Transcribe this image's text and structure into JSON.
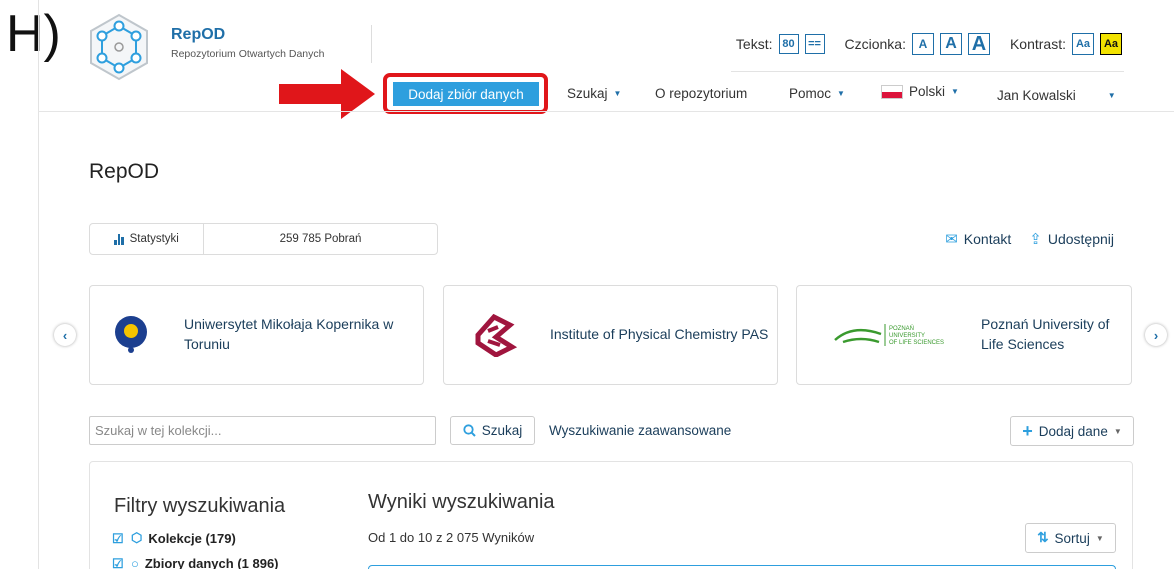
{
  "panel_letter": "H)",
  "brand": {
    "title": "RepOD",
    "subtitle": "Repozytorium Otwartych Danych"
  },
  "accessibility": {
    "text_label": "Tekst:",
    "text_opt1": "80",
    "text_opt2": "==",
    "font_label": "Czcionka:",
    "font_small": "A",
    "font_medium": "A",
    "font_large": "A",
    "contrast_label": "Kontrast:",
    "contrast_normal": "Aa",
    "contrast_high": "Aa"
  },
  "nav": {
    "add_dataset": "Dodaj zbiór danych",
    "search": "Szukaj",
    "about": "O repozytorium",
    "help": "Pomoc",
    "language": "Polski",
    "user": "Jan Kowalski"
  },
  "page_title": "RepOD",
  "stats": {
    "label": "Statystyki",
    "downloads": "259 785 Pobrań"
  },
  "contact": {
    "contact": "Kontakt",
    "share": "Udostępnij"
  },
  "partners": [
    {
      "name": "Uniwersytet Mikołaja Kopernika w Toruniu"
    },
    {
      "name": "Institute of Physical Chemistry PAS"
    },
    {
      "name": "Poznań University of Life Sciences",
      "logo_line1": "POZNAŃ",
      "logo_line2": "UNIVERSITY",
      "logo_line3": "OF LIFE SCIENCES"
    }
  ],
  "search": {
    "placeholder": "Szukaj w tej kolekcji...",
    "button": "Szukaj",
    "advanced": "Wyszukiwanie zaawansowane",
    "add_data": "Dodaj dane"
  },
  "filters": {
    "title": "Filtry wyszukiwania",
    "items": [
      {
        "label": "Kolekcje (179)"
      },
      {
        "label": "Zbiory danych (1 896)"
      }
    ]
  },
  "results": {
    "title": "Wyniki wyszukiwania",
    "count": "Od 1 do 10 z 2 075 Wyników",
    "sort": "Sortuj"
  },
  "colors": {
    "accent": "#2e9fde",
    "brand": "#1f6fa8",
    "highlight": "#e0161a"
  }
}
